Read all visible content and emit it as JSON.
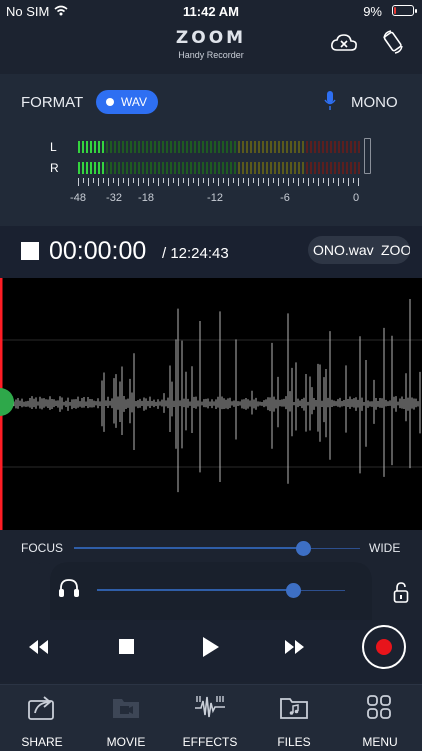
{
  "status": {
    "carrier": "No SIM",
    "time": "11:42 AM",
    "battery": "9%",
    "battery_level": 0.09
  },
  "header": {
    "logo": "ZOOM",
    "subtitle": "Handy Recorder"
  },
  "format": {
    "label": "FORMAT",
    "value": "WAV",
    "mic_mode": "MONO"
  },
  "meter": {
    "channels": [
      "L",
      "R"
    ],
    "scale": [
      "-48",
      "-32",
      "-18",
      "-12",
      "-6",
      "0"
    ],
    "level_L": 0.1,
    "level_R": 0.1
  },
  "transport_time": {
    "elapsed": "00:00:00",
    "remaining": "/ 12:24:43",
    "file_name": "ONO.wav",
    "file_prefix": "ZOO"
  },
  "focus": {
    "left_label": "FOCUS",
    "right_label": "WIDE",
    "value": 0.8
  },
  "monitor": {
    "value": 0.79
  },
  "tabs": [
    {
      "label": "SHARE"
    },
    {
      "label": "MOVIE"
    },
    {
      "label": "EFFECTS"
    },
    {
      "label": "FILES"
    },
    {
      "label": "MENU"
    }
  ],
  "colors": {
    "accent": "#2e6ff2",
    "record": "#e8141b",
    "playhead": "#ff1d25",
    "meter_green": "#2ecc40"
  }
}
